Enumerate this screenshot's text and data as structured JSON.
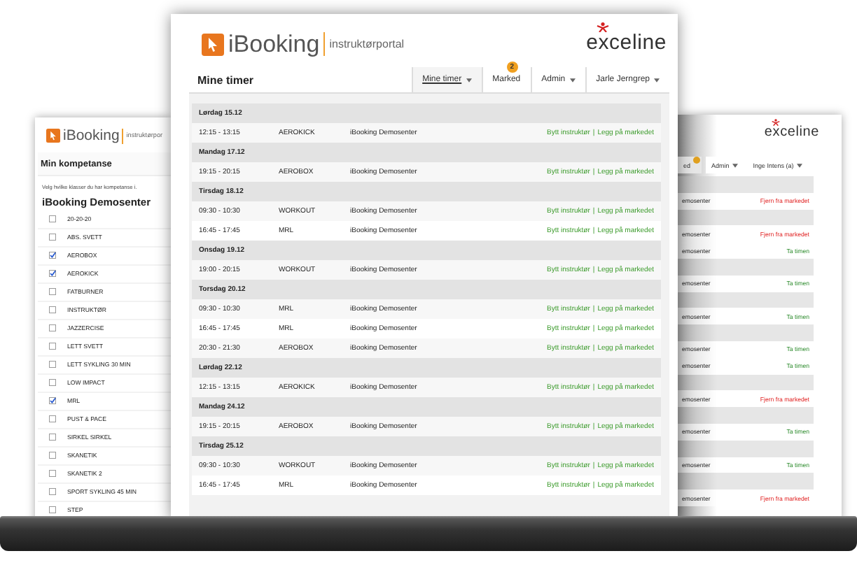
{
  "back_left_window": {
    "logo": {
      "name": "iBooking",
      "subtitle": "instruktørpor"
    },
    "title": "Min kompetanse",
    "hint": "Velg hvilke klasser du har kompetanse i.",
    "group": "iBooking Demosenter",
    "classes": [
      {
        "label": "20-20-20",
        "checked": false
      },
      {
        "label": "ABS. SVETT",
        "checked": false
      },
      {
        "label": "AEROBOX",
        "checked": true
      },
      {
        "label": "AEROKICK",
        "checked": true
      },
      {
        "label": "FATBURNER",
        "checked": false
      },
      {
        "label": "INSTRUKTØR",
        "checked": false
      },
      {
        "label": "JAZZERCISE",
        "checked": false
      },
      {
        "label": "LETT SVETT",
        "checked": false
      },
      {
        "label": "LETT SYKLING 30 MIN",
        "checked": false
      },
      {
        "label": "LOW IMPACT",
        "checked": false
      },
      {
        "label": "MRL",
        "checked": true
      },
      {
        "label": "PUST & PACE",
        "checked": false
      },
      {
        "label": "SIRKEL SIRKEL",
        "checked": false
      },
      {
        "label": "SKANETIK",
        "checked": false
      },
      {
        "label": "SKANETIK 2",
        "checked": false
      },
      {
        "label": "SPORT SYKLING 45 MIN",
        "checked": false
      },
      {
        "label": "STEP",
        "checked": false
      }
    ]
  },
  "main_window": {
    "logo": {
      "name": "iBooking",
      "subtitle": "instruktørportal"
    },
    "brand": "exceline",
    "heading": "Mine timer",
    "tabs": [
      {
        "label": "Mine timer",
        "selected": true,
        "dropdown": true
      },
      {
        "label": "Marked",
        "selected": false,
        "dropdown": false,
        "badge": "2"
      },
      {
        "label": "Admin",
        "selected": false,
        "dropdown": true
      },
      {
        "label": "Jarle Jerngrep",
        "selected": false,
        "dropdown": true
      }
    ],
    "rows": [
      {
        "kind": "day",
        "label": "Lørdag 15.12"
      },
      {
        "kind": "class",
        "time": "12:15 - 13:15",
        "class": "AEROKICK",
        "venue": "iBooking Demosenter",
        "actions": [
          "Bytt instruktør",
          "Legg på markedet"
        ],
        "separator": "|"
      },
      {
        "kind": "day",
        "label": "Mandag 17.12"
      },
      {
        "kind": "class",
        "time": "19:15 - 20:15",
        "class": "AEROBOX",
        "venue": "iBooking Demosenter",
        "actions": [
          "Bytt instruktør",
          "Legg på markedet"
        ],
        "separator": "|"
      },
      {
        "kind": "day",
        "label": "Tirsdag 18.12"
      },
      {
        "kind": "class",
        "time": "09:30 - 10:30",
        "class": "WORKOUT",
        "venue": "iBooking Demosenter",
        "actions": [
          "Bytt instruktør",
          "Legg på markedet"
        ],
        "separator": "|"
      },
      {
        "kind": "class",
        "time": "16:45 - 17:45",
        "class": "MRL",
        "venue": "iBooking Demosenter",
        "actions": [
          "Bytt instruktør",
          "Legg på markedet"
        ],
        "separator": "|"
      },
      {
        "kind": "day",
        "label": "Onsdag 19.12"
      },
      {
        "kind": "class",
        "time": "19:00 - 20:15",
        "class": "WORKOUT",
        "venue": "iBooking Demosenter",
        "actions": [
          "Bytt instruktør",
          "Legg på markedet"
        ],
        "separator": "|"
      },
      {
        "kind": "day",
        "label": "Torsdag 20.12"
      },
      {
        "kind": "class",
        "time": "09:30 - 10:30",
        "class": "MRL",
        "venue": "iBooking Demosenter",
        "actions": [
          "Bytt instruktør",
          "Legg på markedet"
        ],
        "separator": "|"
      },
      {
        "kind": "class",
        "time": "16:45 - 17:45",
        "class": "MRL",
        "venue": "iBooking Demosenter",
        "actions": [
          "Bytt instruktør",
          "Legg på markedet"
        ],
        "separator": "|"
      },
      {
        "kind": "class",
        "time": "20:30 - 21:30",
        "class": "AEROBOX",
        "venue": "iBooking Demosenter",
        "actions": [
          "Bytt instruktør",
          "Legg på markedet"
        ],
        "separator": "|"
      },
      {
        "kind": "day",
        "label": "Lørdag 22.12"
      },
      {
        "kind": "class",
        "time": "12:15 - 13:15",
        "class": "AEROKICK",
        "venue": "iBooking Demosenter",
        "actions": [
          "Bytt instruktør",
          "Legg på markedet"
        ],
        "separator": "|"
      },
      {
        "kind": "day",
        "label": "Mandag 24.12"
      },
      {
        "kind": "class",
        "time": "19:15 - 20:15",
        "class": "AEROBOX",
        "venue": "iBooking Demosenter",
        "actions": [
          "Bytt instruktør",
          "Legg på markedet"
        ],
        "separator": "|"
      },
      {
        "kind": "day",
        "label": "Tirsdag 25.12"
      },
      {
        "kind": "class",
        "time": "09:30 - 10:30",
        "class": "WORKOUT",
        "venue": "iBooking Demosenter",
        "actions": [
          "Bytt instruktør",
          "Legg på markedet"
        ],
        "separator": "|"
      },
      {
        "kind": "class",
        "time": "16:45 - 17:45",
        "class": "MRL",
        "venue": "iBooking Demosenter",
        "actions": [
          "Bytt instruktør",
          "Legg på markedet"
        ],
        "separator": "|"
      }
    ]
  },
  "back_right_window": {
    "brand": "exceline",
    "tabs": [
      {
        "label": "ed",
        "selected": true,
        "dropdown": false,
        "badge_dot": true
      },
      {
        "label": "Admin",
        "selected": false,
        "dropdown": true,
        "badge_dot": false
      },
      {
        "label": "Inge Intens (a)",
        "selected": false,
        "dropdown": true,
        "badge_dot": false
      }
    ],
    "rows": [
      {
        "kind": "day"
      },
      {
        "kind": "class",
        "venue": "emosenter",
        "action": "Fjern fra markedet",
        "remove": true
      },
      {
        "kind": "day"
      },
      {
        "kind": "class",
        "venue": "emosenter",
        "action": "Fjern fra markedet",
        "remove": true
      },
      {
        "kind": "class",
        "venue": "emosenter",
        "action": "Ta timen",
        "remove": false
      },
      {
        "kind": "day"
      },
      {
        "kind": "class",
        "venue": "emosenter",
        "action": "Ta timen",
        "remove": false
      },
      {
        "kind": "day"
      },
      {
        "kind": "class",
        "venue": "emosenter",
        "action": "Ta timen",
        "remove": false
      },
      {
        "kind": "day"
      },
      {
        "kind": "class",
        "venue": "emosenter",
        "action": "Ta timen",
        "remove": false
      },
      {
        "kind": "class",
        "venue": "emosenter",
        "action": "Ta timen",
        "remove": false
      },
      {
        "kind": "day"
      },
      {
        "kind": "class",
        "venue": "emosenter",
        "action": "Fjern fra markedet",
        "remove": true
      },
      {
        "kind": "day"
      },
      {
        "kind": "class",
        "venue": "emosenter",
        "action": "Ta timen",
        "remove": false
      },
      {
        "kind": "day"
      },
      {
        "kind": "class",
        "venue": "emosenter",
        "action": "Ta timen",
        "remove": false
      },
      {
        "kind": "day"
      },
      {
        "kind": "class",
        "venue": "emosenter",
        "action": "Fjern fra markedet",
        "remove": true
      }
    ]
  }
}
